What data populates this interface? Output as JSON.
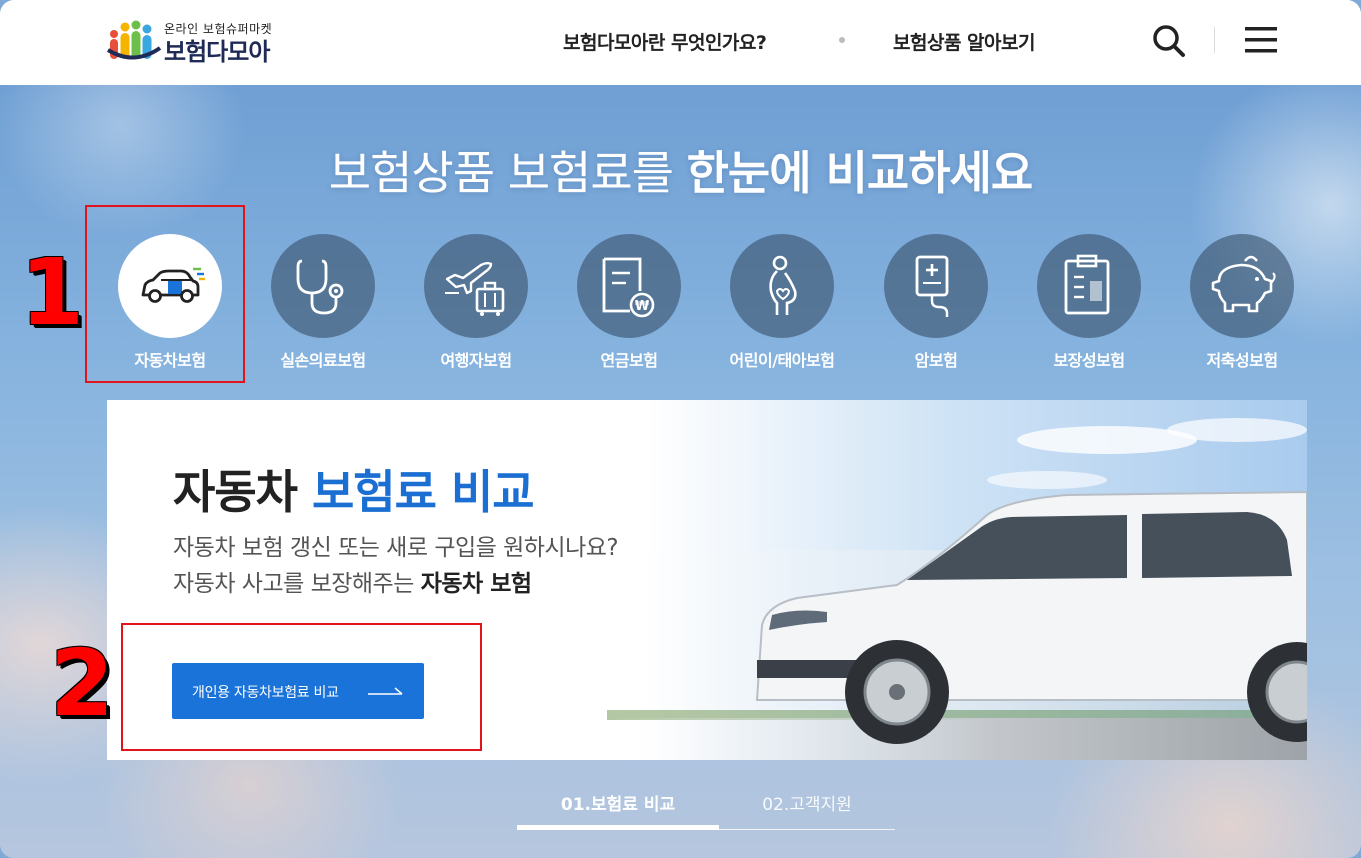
{
  "header": {
    "logo_small": "온라인 보험슈퍼마켓",
    "logo_big": "보험다모아",
    "nav": [
      "보험다모아란 무엇인가요?",
      "보험상품 알아보기"
    ]
  },
  "hero": {
    "title_light": "보험상품 보험료를",
    "title_strong": "한눈에 비교하세요"
  },
  "categories": [
    {
      "label": "자동차보험",
      "icon": "car-icon",
      "active": true
    },
    {
      "label": "실손의료보험",
      "icon": "stethoscope-icon",
      "active": false
    },
    {
      "label": "여행자보험",
      "icon": "airplane-luggage-icon",
      "active": false
    },
    {
      "label": "연금보험",
      "icon": "pension-document-icon",
      "active": false
    },
    {
      "label": "어린이/태아보험",
      "icon": "pregnant-icon",
      "active": false
    },
    {
      "label": "암보험",
      "icon": "iv-bag-icon",
      "active": false
    },
    {
      "label": "보장성보험",
      "icon": "clipboard-icon",
      "active": false
    },
    {
      "label": "저축성보험",
      "icon": "piggy-bank-icon",
      "active": false
    }
  ],
  "card": {
    "title_dark": "자동차",
    "title_blue": "보험료 비교",
    "desc_line1": "자동차 보험 갱신 또는 새로 구입을 원하시나요?",
    "desc_line2_plain": "자동차 사고를 보장해주는",
    "desc_line2_bold": "자동차 보험",
    "cta_label": "개인용 자동차보험료 비교"
  },
  "tabs": [
    "01.보험료 비교",
    "02.고객지원"
  ],
  "annotations": [
    "1",
    "2"
  ],
  "colors": {
    "accent": "#1a73d9",
    "title_blue": "#1b6fd2",
    "annotation_red": "#e3131b"
  }
}
